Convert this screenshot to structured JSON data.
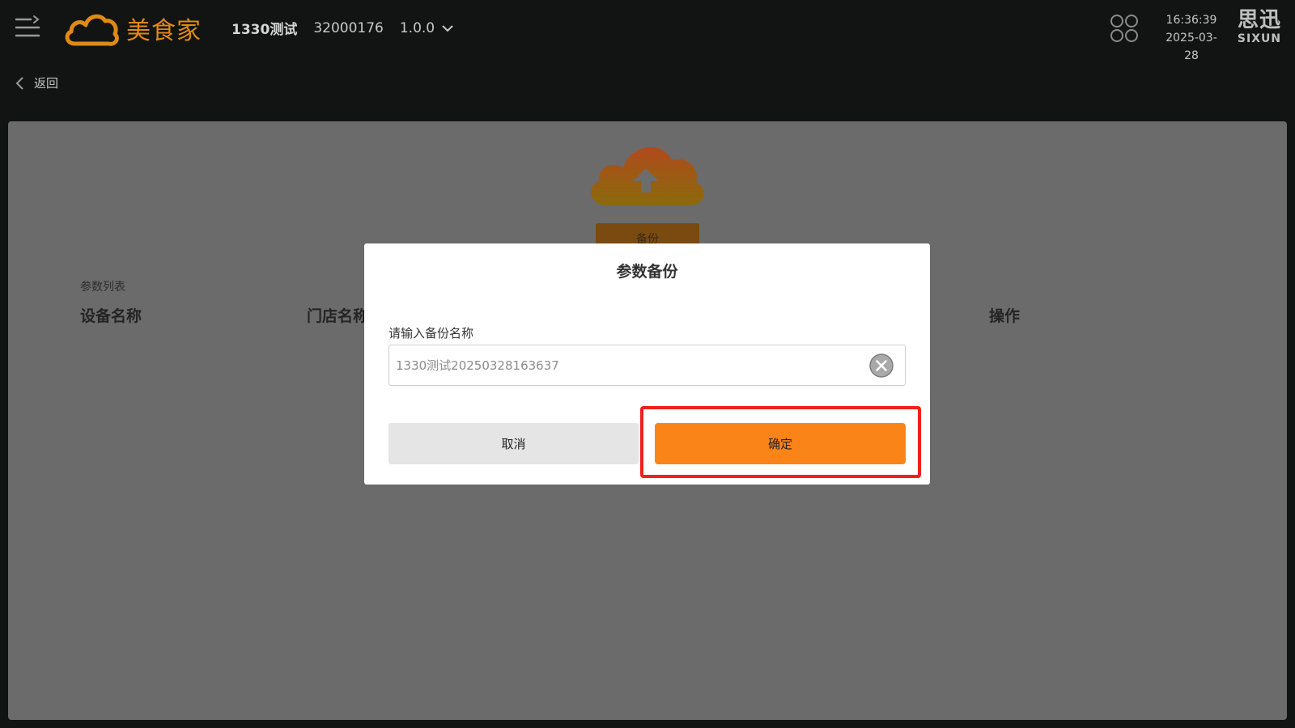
{
  "header": {
    "app_name": "美食家",
    "store_name": "1330测试",
    "store_code": "32000176",
    "version": "1.0.0",
    "time": "16:36:39",
    "date": "2025-03-28",
    "brand_cn": "思迅",
    "brand_en": "SIXUN"
  },
  "nav": {
    "back_label": "返回"
  },
  "main": {
    "backup_button_label": "备份",
    "list_caption": "参数列表",
    "columns": [
      "设备名称",
      "门店名称",
      "操作"
    ]
  },
  "dialog": {
    "title": "参数备份",
    "field_label": "请输入备份名称",
    "input_value": "1330测试20250328163637",
    "cancel_label": "取消",
    "confirm_label": "确定"
  },
  "colors": {
    "accent": "#fb8418",
    "brand_orange": "#e08a14",
    "highlight": "#f0201c",
    "header_bg": "#121414",
    "overlay_panel": "#6b6b6b"
  },
  "icons": [
    "menu-icon",
    "cloud-logo-icon",
    "chevron-down-icon",
    "app-grid-icon",
    "back-chevron-icon",
    "cloud-upload-icon",
    "clear-icon"
  ]
}
